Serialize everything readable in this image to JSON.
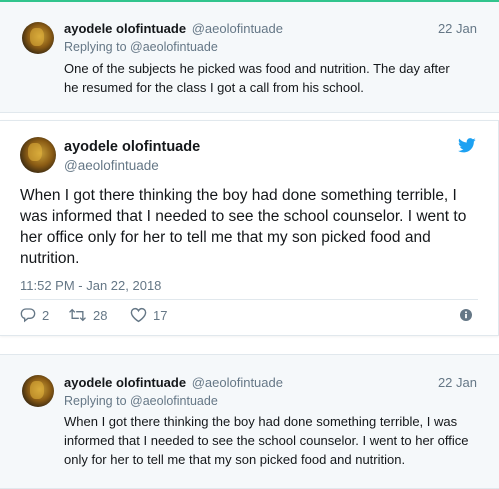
{
  "colors": {
    "accent": "#1da1f2",
    "muted": "#657786",
    "text": "#14171a",
    "top_bar": "#31c48d"
  },
  "reply1": {
    "name": "ayodele olofintuade",
    "handle": "@aeolofintuade",
    "date": "22 Jan",
    "replying_prefix": "Replying to",
    "replying_handle": "@aeolofintuade",
    "text": "One of the subjects he picked was food and nutrition. The day after he resumed for the class I got a call from his school."
  },
  "focus": {
    "name": "ayodele olofintuade",
    "handle": "@aeolofintuade",
    "text": "When I got there thinking the boy had done something terrible, I was informed that I needed to see the school counselor. I went to her office only for her to tell me that my son picked food and nutrition.",
    "timestamp": "11:52 PM - Jan 22, 2018",
    "actions": {
      "replies": "2",
      "retweets": "28",
      "likes": "17"
    },
    "icons": {
      "brand": "twitter-bird-icon",
      "reply": "reply-icon",
      "retweet": "retweet-icon",
      "like": "heart-icon",
      "info": "info-icon"
    }
  },
  "reply2": {
    "name": "ayodele olofintuade",
    "handle": "@aeolofintuade",
    "date": "22 Jan",
    "replying_prefix": "Replying to",
    "replying_handle": "@aeolofintuade",
    "text": "When I got there thinking the boy had done something terrible, I was informed that I needed to see the school counselor. I went to her office only for her to tell me that my son picked food and nutrition."
  }
}
